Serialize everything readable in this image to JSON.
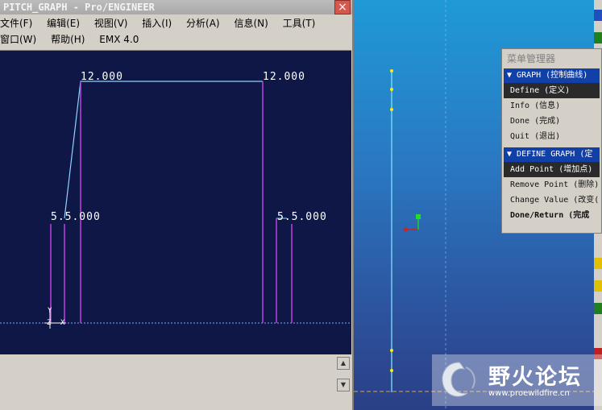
{
  "window": {
    "title": "PITCH_GRAPH - Pro/ENGINEER",
    "close_label": "×"
  },
  "menubar": {
    "row1": [
      "文件(F)",
      "编辑(E)",
      "视图(V)",
      "插入(I)",
      "分析(A)",
      "信息(N)",
      "工具(T)"
    ],
    "row2": [
      "窗口(W)",
      "帮助(H)",
      "EMX 4.0"
    ]
  },
  "graph": {
    "label_top_left": "12.000",
    "label_top_right": "12.000",
    "label_mid_left": "5.5.000",
    "label_mid_right": "5.5.000",
    "axis_y": "Y",
    "axis_z": "Z",
    "axis_x": "X"
  },
  "menu_manager": {
    "title": "菜单管理器",
    "graph_header": "GRAPH (控制曲线)",
    "graph_items": [
      "Define (定义)",
      "Info (信息)",
      "Done (完成)",
      "Quit (退出)"
    ],
    "define_header": "DEFINE GRAPH (定",
    "define_items": [
      "Add Point (增加点)",
      "Remove Point (删除)",
      "Change Value (改变(",
      "Done/Return (完成"
    ]
  },
  "watermark": {
    "text": "野火论坛",
    "url": "www.proewildfire.cn"
  },
  "colors": {
    "graph_bg": "#0e1746",
    "profile_line": "#8fd4ff",
    "vertical_marks": "#c040e0",
    "menu_header": "#1040a8"
  }
}
